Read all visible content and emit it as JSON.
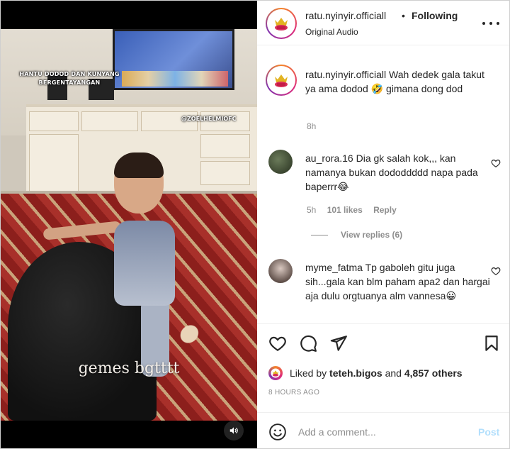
{
  "video": {
    "overlay_title": "HANTU DODOD DAN KUNYANG BERGENTAYANGAN",
    "overlay_tag": "@ZOELHELMIOFC",
    "caption": "gemes bgtttt",
    "sound_icon": "speaker-icon"
  },
  "header": {
    "username": "ratu.nyinyir.officiall",
    "separator": "•",
    "follow_status": "Following",
    "audio": "Original Audio",
    "more_icon": "more-horizontal-icon"
  },
  "post_caption": {
    "username": "ratu.nyinyir.officiall",
    "text": "Wah dedek gala takut ya ama dodod 🤣 gimana dong dod",
    "time": "8h"
  },
  "comments": [
    {
      "username": "au_rora.16",
      "text": "Dia gk salah kok,,, kan namanya bukan dododdddd napa pada baperrr😂",
      "time": "5h",
      "likes": "101 likes",
      "reply": "Reply",
      "view_replies": "View replies (6)"
    },
    {
      "username": "myme_fatma",
      "text": "Tp gaboleh gitu juga sih...gala kan blm paham apa2 dan hargai aja dulu orgtuanya alm vannesa😀"
    }
  ],
  "actions": {
    "like_icon": "heart-icon",
    "comment_icon": "comment-icon",
    "share_icon": "share-icon",
    "save_icon": "bookmark-icon"
  },
  "likes_summary": {
    "prefix": "Liked by",
    "user": "teteh.bigos",
    "middle": "and",
    "count": "4,857 others"
  },
  "post_time": "8 HOURS AGO",
  "add_comment": {
    "placeholder": "Add a comment...",
    "post_label": "Post"
  },
  "colors": {
    "text_primary": "#262626",
    "text_secondary": "#8e8e8e",
    "post_button_disabled": "#b2dffc",
    "divider": "#efefef"
  }
}
